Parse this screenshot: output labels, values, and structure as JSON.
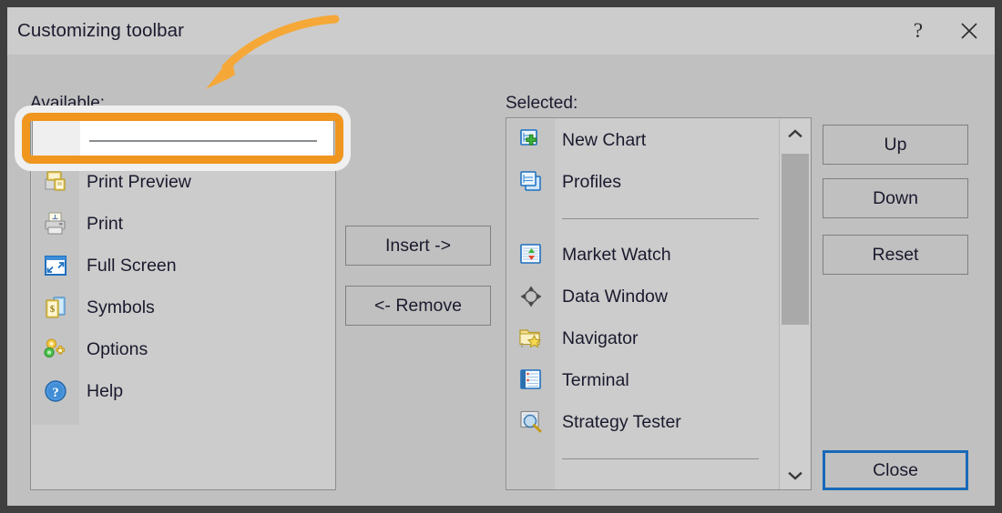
{
  "window": {
    "title": "Customizing toolbar",
    "help_button": "?",
    "close_icon": "close-x-icon"
  },
  "labels": {
    "available": "Available:",
    "selected": "Selected:"
  },
  "available_list": [
    {
      "type": "blank",
      "label": "",
      "icon": "blank-placeholder-icon"
    },
    {
      "type": "item",
      "label": "Print Preview",
      "icon": "print-preview-icon"
    },
    {
      "type": "item",
      "label": "Print",
      "icon": "print-icon"
    },
    {
      "type": "item",
      "label": "Full Screen",
      "icon": "full-screen-icon"
    },
    {
      "type": "item",
      "label": "Symbols",
      "icon": "symbols-icon"
    },
    {
      "type": "item",
      "label": "Options",
      "icon": "options-gear-icon"
    },
    {
      "type": "item",
      "label": "Help",
      "icon": "help-circle-icon"
    }
  ],
  "selected_list": [
    {
      "type": "item",
      "label": "New Chart",
      "icon": "new-chart-icon"
    },
    {
      "type": "item",
      "label": "Profiles",
      "icon": "profiles-icon"
    },
    {
      "type": "separator",
      "label": ""
    },
    {
      "type": "item",
      "label": "Market Watch",
      "icon": "market-watch-icon"
    },
    {
      "type": "item",
      "label": "Data Window",
      "icon": "data-window-crosshair-icon"
    },
    {
      "type": "item",
      "label": "Navigator",
      "icon": "navigator-folder-star-icon"
    },
    {
      "type": "item",
      "label": "Terminal",
      "icon": "terminal-icon"
    },
    {
      "type": "item",
      "label": "Strategy Tester",
      "icon": "strategy-tester-icon"
    },
    {
      "type": "separator",
      "label": ""
    },
    {
      "type": "clipped",
      "label": "",
      "icon": "partial-toolbar-icon"
    }
  ],
  "buttons": {
    "insert": "Insert ->",
    "remove": "<- Remove",
    "up": "Up",
    "down": "Down",
    "reset": "Reset",
    "close": "Close"
  },
  "scrollbar": {
    "up_arrow": "chevron-up-icon",
    "down_arrow": "chevron-down-icon"
  },
  "annotation": {
    "highlight_target": "blank-separator-list-item",
    "arrow": "curved-arrow-pointing-to-highlight",
    "accent_color": "#f0961e",
    "outline_color": "#f0f0f0"
  },
  "colors": {
    "dialog_background": "#c0c0c0",
    "titlebar_background": "#cccccc",
    "panel_background": "#cccccc",
    "panel_border": "#8a8d90",
    "text": "#1a1a2e",
    "focus_border": "#1769b8",
    "scrollbar_track": "#cfcfcf",
    "scrollbar_thumb": "#a9a9a9",
    "window_frame": "#3f3f3f"
  }
}
